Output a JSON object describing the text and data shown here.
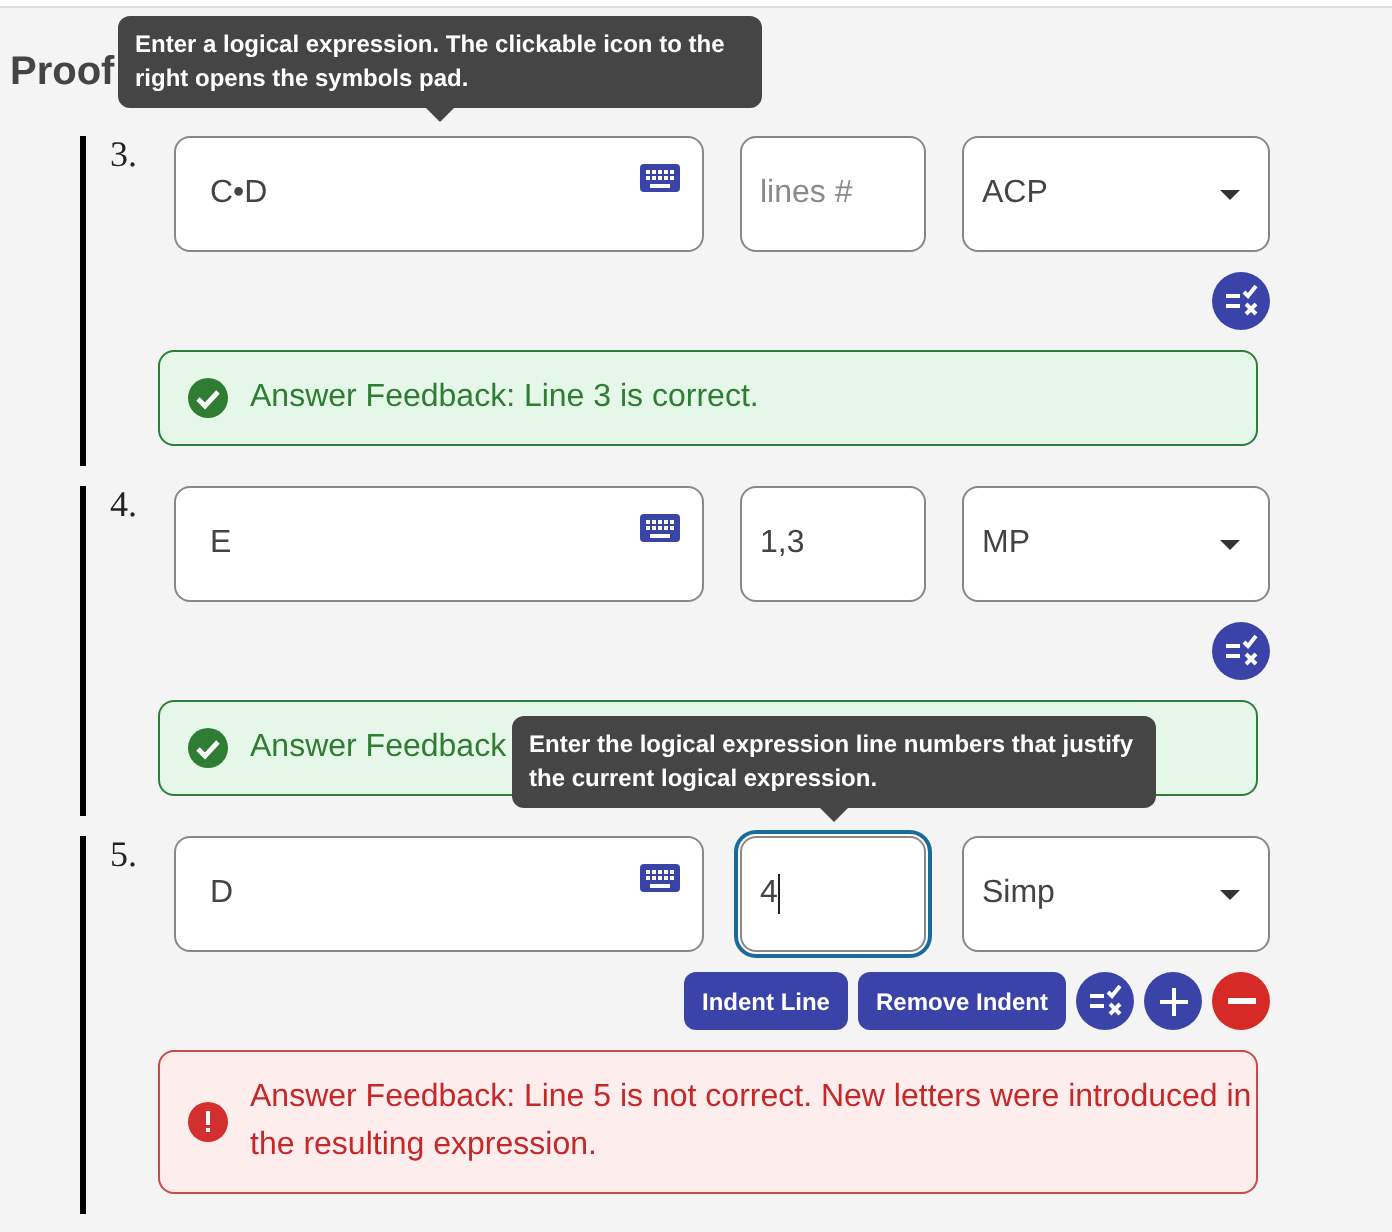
{
  "heading": "Proof",
  "lines": [
    {
      "number": "3.",
      "expression": {
        "value": "C•D",
        "tooltip": "Enter a logical expression. The clickable icon to the right opens the symbols pad."
      },
      "justification": {
        "placeholder": "lines #",
        "focused": false
      },
      "rule": "ACP",
      "feedback": {
        "kind": "correct",
        "text": "Answer Feedback: Line 3 is correct."
      }
    },
    {
      "number": "4.",
      "expression": {
        "value": "E"
      },
      "justification": {
        "value": "1,3",
        "focused": false
      },
      "rule": "MP",
      "feedback": {
        "kind": "correct",
        "text": "Answer Feedback"
      }
    },
    {
      "number": "5.",
      "expression": {
        "value": "D"
      },
      "justification": {
        "value": "4",
        "focused": true,
        "tooltip": "Enter the logical expression line numbers that justify the current logical expression."
      },
      "rule": "Simp",
      "actions": [
        "Indent Line",
        "Remove Indent"
      ],
      "feedback": {
        "kind": "incorrect",
        "text": "Answer Feedback: Line 5 is not correct. New letters were introduced in the resulting expression."
      }
    }
  ]
}
